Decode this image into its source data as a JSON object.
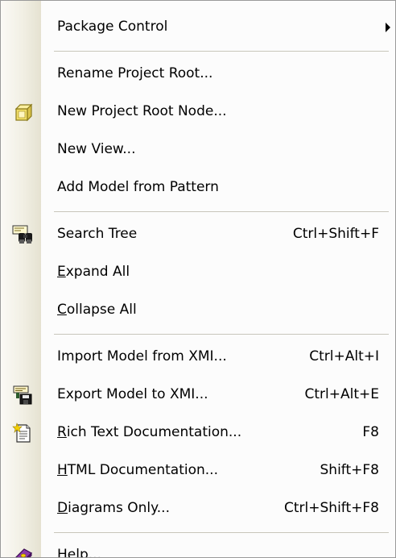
{
  "menu": {
    "package_control": {
      "label": "Package Control"
    },
    "rename_project_root": {
      "label": "Rename Project Root..."
    },
    "new_project_root_node": {
      "label": "New Project Root Node...",
      "icon": "folder-root-icon"
    },
    "new_view": {
      "label": "New View..."
    },
    "add_model_from_pattern": {
      "label": "Add Model from Pattern"
    },
    "search_tree": {
      "label": "Search Tree",
      "shortcut": "Ctrl+Shift+F",
      "icon": "binoculars-icon"
    },
    "expand_all": {
      "mnemonic": "E",
      "rest": "xpand All"
    },
    "collapse_all": {
      "mnemonic": "C",
      "rest": "ollapse All"
    },
    "import_model_from_xmi": {
      "label": "Import Model from XMI...",
      "shortcut": "Ctrl+Alt+I"
    },
    "export_model_to_xmi": {
      "label": "Export Model to XMI...",
      "shortcut": "Ctrl+Alt+E",
      "icon": "export-xmi-icon"
    },
    "rich_text_documentation": {
      "mnemonic": "R",
      "rest": "ich Text Documentation...",
      "shortcut": "F8",
      "icon": "document-icon"
    },
    "html_documentation": {
      "mnemonic": "H",
      "rest": "TML Documentation...",
      "shortcut": "Shift+F8"
    },
    "diagrams_only": {
      "mnemonic": "D",
      "rest": "iagrams Only...",
      "shortcut": "Ctrl+Shift+F8"
    },
    "help": {
      "label": "Help...",
      "icon": "help-book-icon"
    }
  },
  "colors": {
    "menu_background": "#fcfcfc",
    "gutter_gradient_end": "#e5e2d1",
    "separator": "#c8c6bb",
    "border": "#9a9a9a"
  }
}
